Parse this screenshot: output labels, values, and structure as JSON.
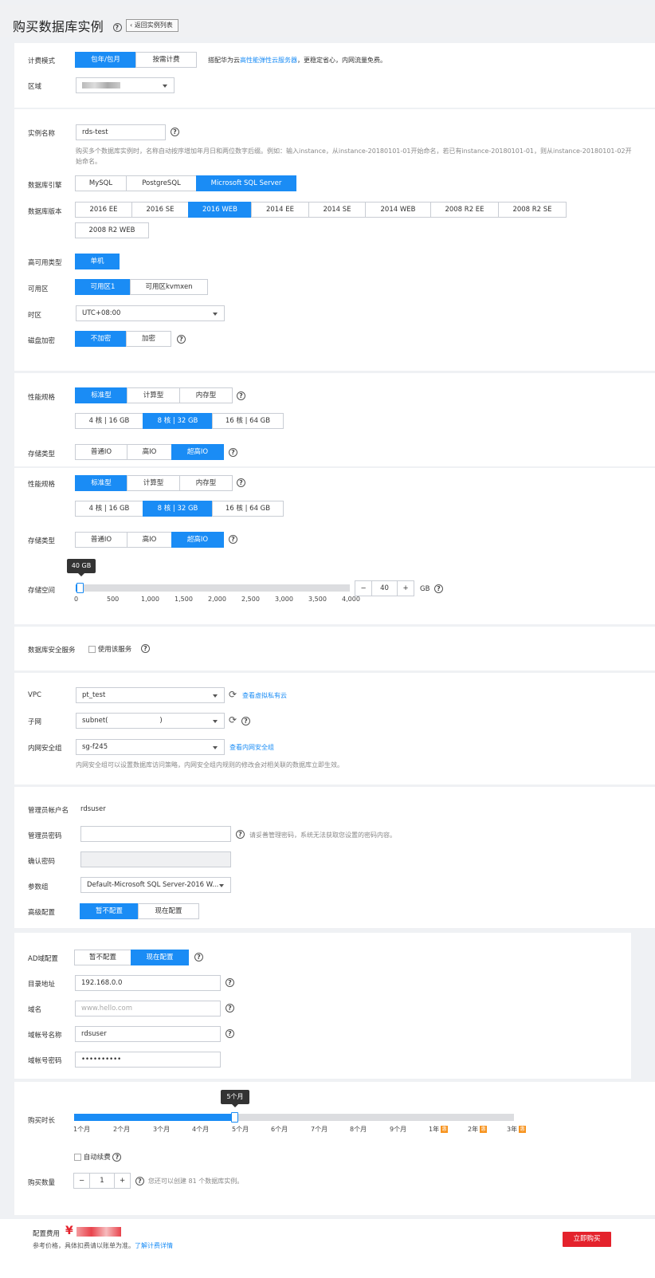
{
  "header": {
    "title": "购买数据库实例",
    "back": "返回实例列表"
  },
  "billing": {
    "label": "计费模式",
    "options": [
      "包年/包月",
      "按需计费"
    ],
    "selected": 0,
    "note": "搭配华为云",
    "note_link": "高性能弹性云服务器",
    "note_tail": "，更稳定省心，内网流量免费。"
  },
  "region": {
    "label": "区域"
  },
  "instance": {
    "label": "实例名称",
    "value": "rds-test",
    "hint": "购买多个数据库实例时，名称自动按序增加年月日和两位数字后缀。例如：输入instance，从instance-20180101-01开始命名，若已有instance-20180101-01，则从instance-20180101-02开始命名。"
  },
  "engine": {
    "label": "数据库引擎",
    "options": [
      "MySQL",
      "PostgreSQL",
      "Microsoft SQL Server"
    ],
    "selected": 2
  },
  "version": {
    "label": "数据库版本",
    "options": [
      "2016 EE",
      "2016 SE",
      "2016 WEB",
      "2014 EE",
      "2014 SE",
      "2014 WEB",
      "2008 R2 EE",
      "2008 R2 SE",
      "2008 R2 WEB"
    ],
    "selected": 2
  },
  "ha": {
    "label": "高可用类型",
    "options": [
      "单机"
    ],
    "selected": 0
  },
  "az": {
    "label": "可用区",
    "options": [
      "可用区1",
      "可用区kvmxen"
    ],
    "selected": 0
  },
  "tz": {
    "label": "时区",
    "value": "UTC+08:00"
  },
  "encrypt": {
    "label": "磁盘加密",
    "options": [
      "不加密",
      "加密"
    ],
    "selected": 0
  },
  "spec": {
    "label": "性能规格",
    "types": [
      "标准型",
      "计算型",
      "内存型"
    ],
    "sizes": [
      "4 核 | 16 GB",
      "8 核 | 32 GB",
      "16 核 | 64 GB"
    ],
    "selected_type": 0,
    "selected_size": 1
  },
  "storage_type": {
    "label": "存储类型",
    "options": [
      "普通IO",
      "高IO",
      "超高IO"
    ],
    "selected": 2
  },
  "storage": {
    "label": "存储空间",
    "tip": "40 GB",
    "ticks": [
      "0",
      "500",
      "1,000",
      "1,500",
      "2,000",
      "2,500",
      "3,000",
      "3,500",
      "4,000"
    ],
    "value": "40",
    "unit": "GB",
    "minus": "−",
    "plus": "+",
    "fraction": 0.01
  },
  "security": {
    "label": "数据库安全服务",
    "option": "使用该服务"
  },
  "vpc": {
    "label": "VPC",
    "value": "pt_test",
    "link": "查看虚拟私有云"
  },
  "subnet": {
    "label": "子网",
    "value": "subnet(                        )"
  },
  "sg": {
    "label": "内网安全组",
    "value": "sg-f245",
    "link": "查看内网安全组",
    "hint": "内网安全组可以设置数据库访问策略，内网安全组内规则的修改会对相关联的数据库立即生效。"
  },
  "admin": {
    "label": "管理员帐户名",
    "value": "rdsuser"
  },
  "pwd": {
    "label": "管理员密码",
    "hint": "请妥善管理密码，系统无法获取您设置的密码内容。"
  },
  "confirm": {
    "label": "确认密码"
  },
  "param": {
    "label": "参数组",
    "value": "Default-Microsoft SQL Server-2016 W..."
  },
  "advanced": {
    "label": "高级配置",
    "options": [
      "暂不配置",
      "现在配置"
    ],
    "selected": 0
  },
  "ad": {
    "label": "AD域配置",
    "options": [
      "暂不配置",
      "现在配置"
    ],
    "selected": 1
  },
  "dir": {
    "label": "目录地址",
    "value": "192.168.0.0"
  },
  "domain": {
    "label": "域名",
    "value": "www.hello.com"
  },
  "domain_user": {
    "label": "域帐号名称",
    "value": "rdsuser"
  },
  "domain_pwd": {
    "label": "域帐号密码",
    "value": "••••••••••"
  },
  "duration": {
    "label": "购买时长",
    "tip": "5个月",
    "ticks": [
      "1个月",
      "2个月",
      "3个月",
      "4个月",
      "5个月",
      "6个月",
      "7个月",
      "8个月",
      "9个月",
      "1年",
      "2年",
      "3年"
    ],
    "discount": "惠",
    "auto_renew": "自动续费",
    "selected": 4
  },
  "quantity": {
    "label": "购买数量",
    "value": "1",
    "minus": "−",
    "plus": "+",
    "hint": "您还可以创建 81 个数据库实例。"
  },
  "footer": {
    "fee_label": "配置费用",
    "currency": "¥",
    "ref": "参考价格，具体扣费请以账单为准。",
    "ref_link": "了解计费详情",
    "buy": "立即购买"
  },
  "colors": {
    "accent": "#1a8cf5",
    "buy": "#e4222c",
    "discount": "#f7931e"
  }
}
